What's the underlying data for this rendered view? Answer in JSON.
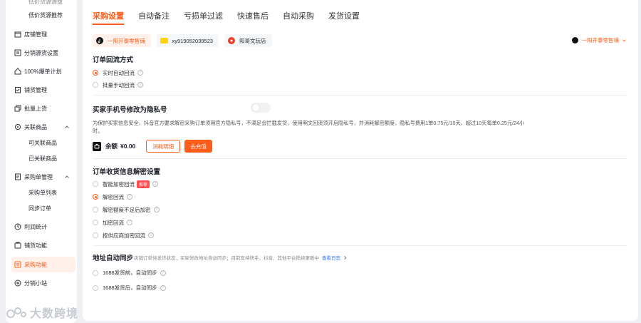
{
  "sidebar": {
    "top_partial": "低价货源源拔",
    "items": [
      {
        "label": "低价货源推荐",
        "sub": true
      },
      {
        "label": "店铺管理",
        "icon": "store-icon"
      },
      {
        "label": "分销源货设置",
        "icon": "settings-list-icon"
      },
      {
        "label": "100%爆单计划",
        "icon": "home-icon"
      },
      {
        "label": "铺货管理",
        "icon": "clipboard-icon"
      },
      {
        "label": "批量上货",
        "icon": "copy-icon"
      },
      {
        "label": "关联商品",
        "icon": "link-icon",
        "expanded": true
      },
      {
        "label": "可关联商品",
        "sub": true
      },
      {
        "label": "已关联商品",
        "sub": true
      },
      {
        "label": "采购单管理",
        "icon": "order-icon",
        "expanded": true
      },
      {
        "label": "采购单列表",
        "sub": true
      },
      {
        "label": "同步订单",
        "sub": true
      },
      {
        "label": "利润统计",
        "icon": "stats-icon"
      },
      {
        "label": "铺货功能",
        "icon": "function-icon"
      },
      {
        "label": "采购功能",
        "icon": "purchase-icon",
        "active": true
      },
      {
        "label": "分销小站",
        "icon": "station-icon"
      }
    ]
  },
  "tabs": [
    "采购设置",
    "自动备注",
    "亏损单过滤",
    "快速售后",
    "自动采购",
    "发货设置"
  ],
  "active_tab": "采购设置",
  "shops": [
    {
      "name": "一阳开泰零售铺",
      "icon": "douyin-icon",
      "active": true
    },
    {
      "name": "xy919052039523",
      "icon": "xianyu-icon"
    },
    {
      "name": "阳哥文玩店",
      "icon": "shop-red-icon"
    }
  ],
  "shop_selector": "一阳开泰零售铺",
  "order_backflow": {
    "title": "订单回流方式",
    "options": [
      {
        "label": "实时自动回流",
        "checked": true
      },
      {
        "label": "批量手动回流",
        "checked": false
      }
    ]
  },
  "privacy_number": {
    "title": "买家手机号修改为隐私号",
    "description": "为保护买家信息安全，抖音官方要求解密采购订单须用官方隐私号，不满足会拦截发货，使用明文回流须开启隐私号，并消耗解密额度，隐私号费用1单0.75元/10天，超过10天每单0.25元/24小时。",
    "balance_label": "余额",
    "balance_value": "¥0.00",
    "detail_button": "消耗明细",
    "recharge_button": "去充值"
  },
  "decrypt_settings": {
    "title": "订单收货信息解密设置",
    "options": [
      {
        "label": "智能加密回流",
        "checked": false,
        "badge": "推荐"
      },
      {
        "label": "解密回流",
        "checked": true
      },
      {
        "label": "解密额度不足后加密",
        "checked": false
      },
      {
        "label": "加密回流",
        "checked": false
      },
      {
        "label": "按供应商加密回流",
        "checked": false
      }
    ]
  },
  "address_sync": {
    "title": "地址自动同步",
    "description": "店铺订单待发货状态，买家修改地址自动同步；目前支持快手、抖音、其他平台陆续更新中",
    "link": "查看日志",
    "options": [
      {
        "label": "1688发货前，自动同步"
      },
      {
        "label": "1688发货后，自动同步"
      }
    ]
  },
  "watermark": "大数跨境",
  "colors": {
    "accent": "#ff5c1a",
    "link": "#3370ff"
  }
}
